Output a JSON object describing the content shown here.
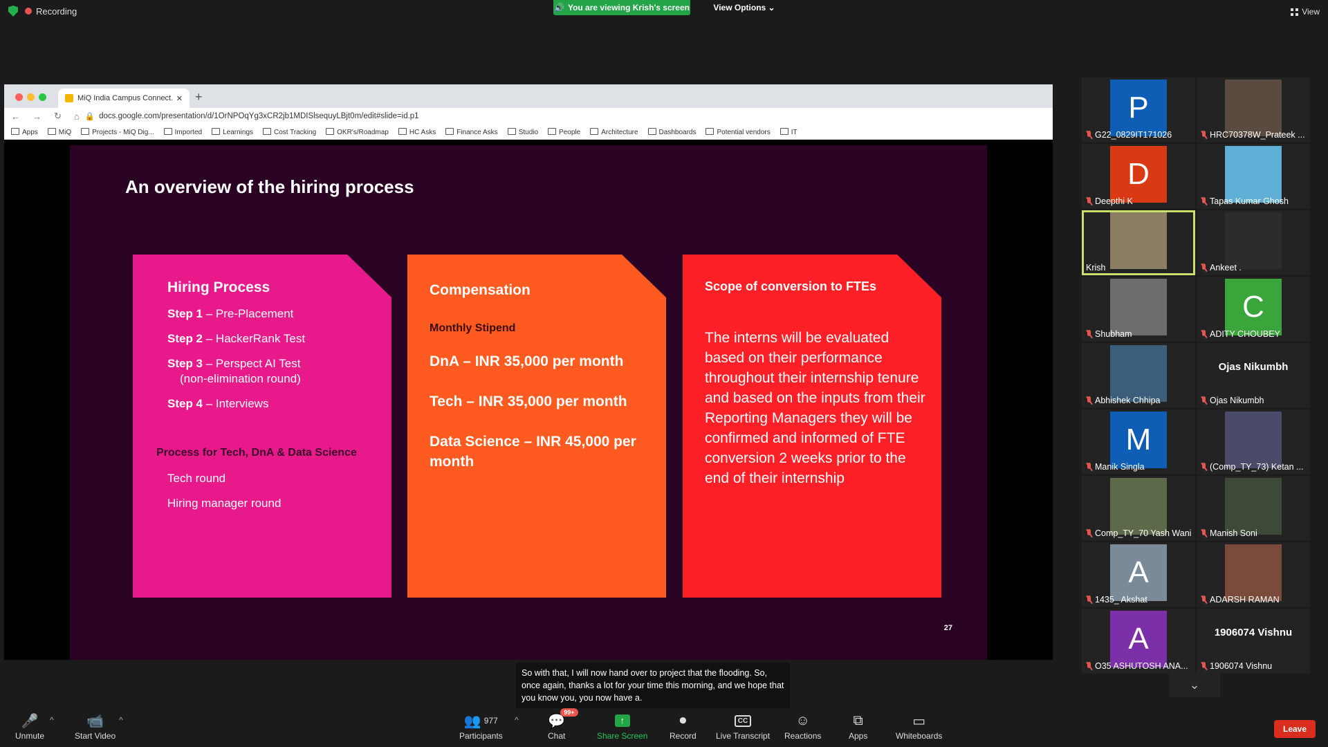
{
  "topbar": {
    "recording": "Recording",
    "viewing": "You are viewing Krish's screen",
    "view_options": "View Options",
    "view": "View"
  },
  "browser": {
    "tab_title": "MiQ India Campus Connect.pp",
    "url": "docs.google.com/presentation/d/1OrNPOqYg3xCR2jb1MDISlsequyLBjt0m/edit#slide=id.p1",
    "bookmarks": [
      "Apps",
      "MiQ",
      "Projects - MiQ Dig...",
      "Imported",
      "Learnings",
      "Cost Tracking",
      "OKR's/Roadmap",
      "HC Asks",
      "Finance Asks",
      "Studio",
      "People",
      "Architecture",
      "Dashboards",
      "Potential vendors",
      "IT"
    ]
  },
  "slide": {
    "title": "An overview of the hiring process",
    "page": "27",
    "card1": {
      "heading": "Hiring Process",
      "steps": [
        {
          "k": "Step 1",
          "v": " – Pre-Placement"
        },
        {
          "k": "Step 2",
          "v": " – HackerRank Test"
        },
        {
          "k": "Step 3",
          "v": " – Perspect AI Test"
        },
        {
          "k": "Step 4",
          "v": " – Interviews"
        }
      ],
      "step3_note": "(non-elimination round)",
      "sub": "Process for Tech, DnA & Data Science",
      "rounds": [
        "Tech round",
        "Hiring manager round"
      ]
    },
    "card2": {
      "heading": "Compensation",
      "sub": "Monthly Stipend",
      "lines": [
        "DnA – INR 35,000 per month",
        "Tech – INR 35,000 per month",
        "Data Science – INR 45,000 per month"
      ]
    },
    "card3": {
      "heading": "Scope of conversion to FTEs",
      "body": "The interns will be evaluated based on their performance throughout their internship tenure and based on the inputs from their Reporting Managers they will be confirmed and informed of FTE conversion 2 weeks prior to the end of their internship"
    }
  },
  "participants": [
    {
      "name": "G22_0829IT171026",
      "initial": "P",
      "color": "#0e5eb5"
    },
    {
      "name": "HRC70378W_Prateek ...",
      "initial": "",
      "color": "#5a4a40"
    },
    {
      "name": "Deepthi K",
      "initial": "D",
      "color": "#d93a14"
    },
    {
      "name": "Tapas Kumar Ghosh",
      "initial": "",
      "color": "#5eaed6"
    },
    {
      "name": "Krish",
      "initial": "",
      "color": "#8b7d62"
    },
    {
      "name": "Ankeet .",
      "initial": "",
      "color": "#2c2c2c"
    },
    {
      "name": "Shubham",
      "initial": "",
      "color": "#6d6d6d"
    },
    {
      "name": "ADITY CHOUBEY",
      "initial": "C",
      "color": "#3aa53a"
    },
    {
      "name": "Abhishek Chhipa",
      "initial": "",
      "color": "#3b5e7a"
    },
    {
      "name": "Ojas Nikumbh",
      "initial": "",
      "color": "",
      "bigname": "Ojas Nikumbh"
    },
    {
      "name": "Manik Singla",
      "initial": "M",
      "color": "#0e5eb5"
    },
    {
      "name": "(Comp_TY_73) Ketan ...",
      "initial": "",
      "color": "#4a4a6a"
    },
    {
      "name": "Comp_TY_70 Yash Wani",
      "initial": "",
      "color": "#5d6a4a"
    },
    {
      "name": "Manish Soni",
      "initial": "",
      "color": "#3d4a3a"
    },
    {
      "name": "1435_ Akshat",
      "initial": "A",
      "color": "#7a8a99"
    },
    {
      "name": "ADARSH RAMAN",
      "initial": "",
      "color": "#7a4a3a"
    },
    {
      "name": "O35 ASHUTOSH ANA...",
      "initial": "A",
      "color": "#7b2fa8"
    },
    {
      "name": "1906074 Vishnu",
      "initial": "",
      "color": "",
      "bigname": "1906074 Vishnu"
    }
  ],
  "caption": "So with that, I will now hand over to project that the flooding. So, once again, thanks a lot for your time this morning, and we hope that you know you, you now have a.",
  "toolbar": {
    "unmute": "Unmute",
    "start_video": "Start Video",
    "participants": "Participants",
    "participant_count": "977",
    "chat": "Chat",
    "chat_badge": "99+",
    "share": "Share Screen",
    "record": "Record",
    "live": "Live Transcript",
    "reactions": "Reactions",
    "apps": "Apps",
    "whiteboards": "Whiteboards",
    "leave": "Leave"
  },
  "colors": {
    "share_green": "#22a447",
    "leave_red": "#d92d20",
    "active_speaker": "#c9e06a"
  }
}
